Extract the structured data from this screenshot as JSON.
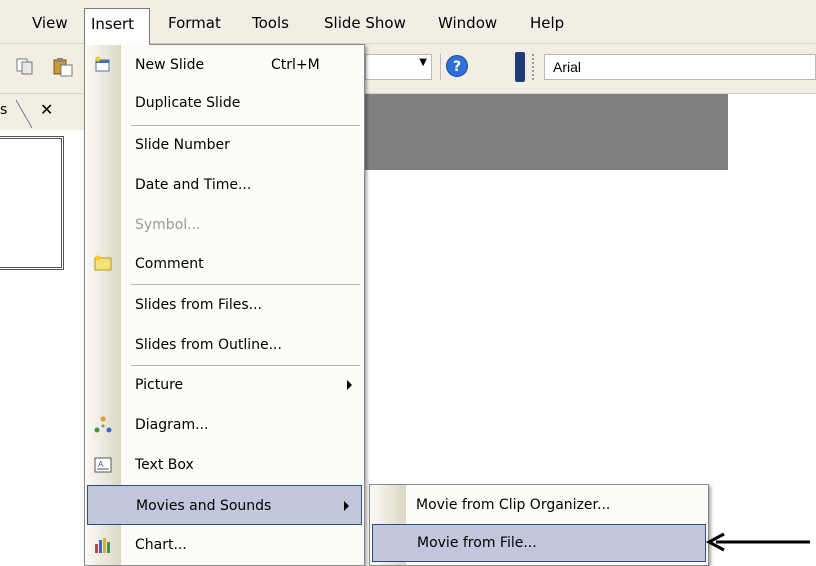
{
  "menubar": {
    "items": [
      "View",
      "Insert",
      "Format",
      "Tools",
      "Slide Show",
      "Window",
      "Help"
    ],
    "active": "Insert"
  },
  "toolbar": {
    "font_name": "Arial",
    "help_glyph": "?"
  },
  "panel": {
    "tab_label": "s",
    "close_glyph": "✕"
  },
  "insert_menu": {
    "items": [
      {
        "label": "New Slide",
        "shortcut": "Ctrl+M",
        "icon": "new-slide-icon"
      },
      {
        "label": "Duplicate Slide"
      },
      {
        "label": "Slide Number"
      },
      {
        "label": "Date and Time..."
      },
      {
        "label": "Symbol...",
        "disabled": true
      },
      {
        "label": "Comment",
        "icon": "comment-icon"
      },
      {
        "label": "Slides from Files..."
      },
      {
        "label": "Slides from Outline..."
      },
      {
        "label": "Picture",
        "submenu": true
      },
      {
        "label": "Diagram...",
        "icon": "diagram-icon"
      },
      {
        "label": "Text Box",
        "icon": "text-box-icon"
      },
      {
        "label": "Movies and Sounds",
        "submenu": true,
        "highlighted": true
      },
      {
        "label": "Chart...",
        "icon": "chart-icon"
      }
    ]
  },
  "movies_submenu": {
    "items": [
      {
        "label": "Movie from Clip Organizer..."
      },
      {
        "label": "Movie from File...",
        "highlighted": true
      }
    ]
  },
  "colors": {
    "menu_bar_bg": "#f1efe4",
    "highlight_bg": "#c1c8dd",
    "highlight_border": "#314b80",
    "slide_gray": "#808080"
  }
}
